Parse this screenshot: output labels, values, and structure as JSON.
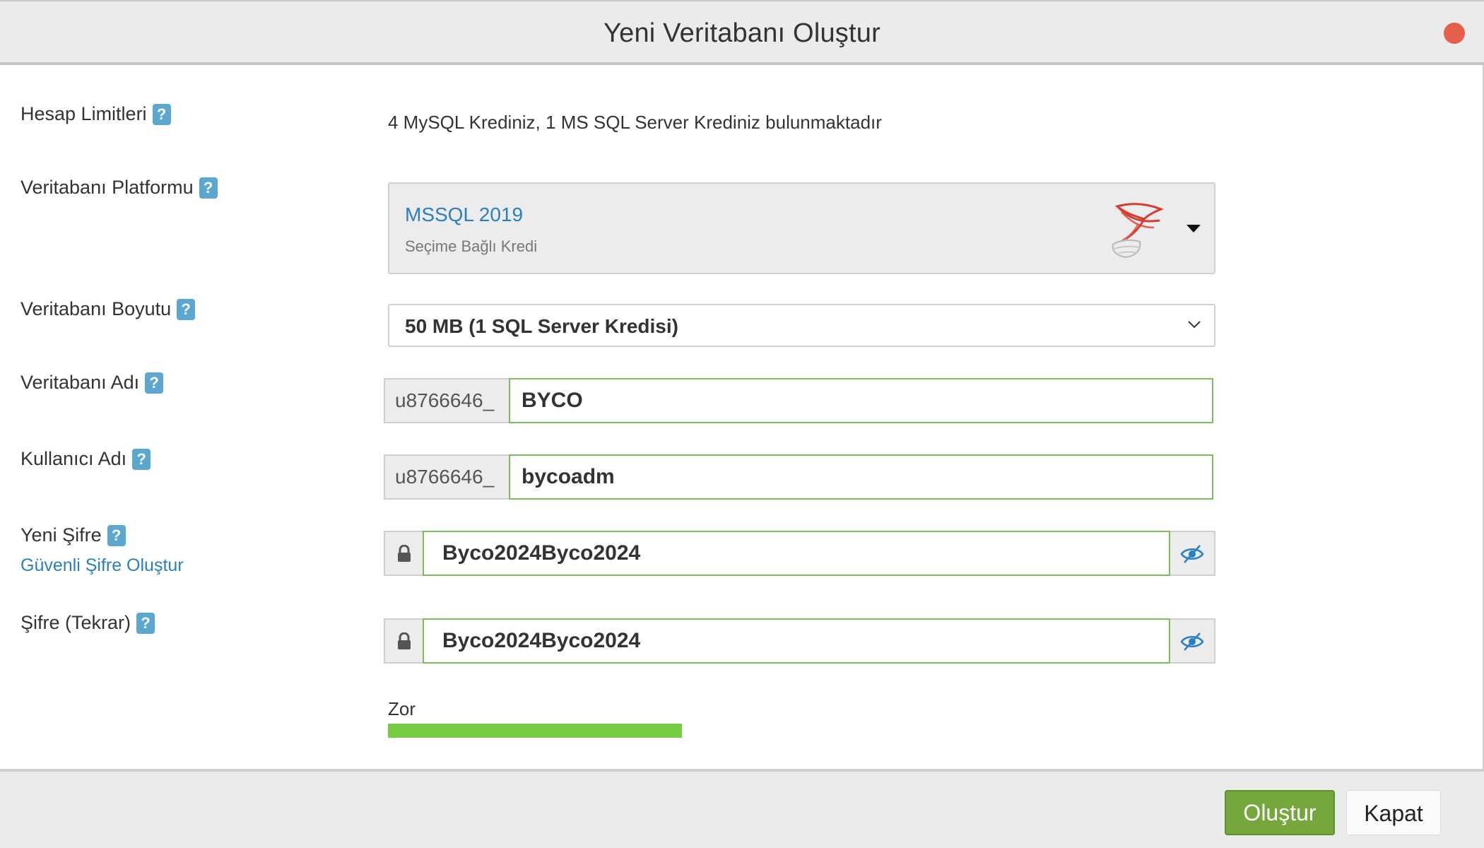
{
  "dialog": {
    "title": "Yeni Veritabanı Oluştur"
  },
  "fields": {
    "account_limits": {
      "label": "Hesap Limitleri",
      "help": "?",
      "value": "4 MySQL Krediniz, 1 MS SQL Server Krediniz bulunmaktadır"
    },
    "platform": {
      "label": "Veritabanı Platformu",
      "help": "?",
      "selected": "MSSQL 2019",
      "subtitle": "Seçime Bağlı Kredi",
      "icon": "sql-server-icon"
    },
    "size": {
      "label": "Veritabanı Boyutu",
      "help": "?",
      "selected": "50 MB (1 SQL Server Kredisi)"
    },
    "db_name": {
      "label": "Veritabanı Adı",
      "help": "?",
      "prefix": "u8766646_",
      "value": "BYCO"
    },
    "username": {
      "label": "Kullanıcı Adı",
      "help": "?",
      "prefix": "u8766646_",
      "value": "bycoadm"
    },
    "new_password": {
      "label": "Yeni Şifre",
      "help": "?",
      "generate_link": "Güvenli Şifre Oluştur",
      "value": "Byco2024Byco2024"
    },
    "password_repeat": {
      "label": "Şifre (Tekrar)",
      "help": "?",
      "value": "Byco2024Byco2024"
    }
  },
  "strength": {
    "label": "Zor",
    "level": 1.0,
    "color": "#77cc44"
  },
  "footer": {
    "create_label": "Oluştur",
    "close_label": "Kapat"
  },
  "colors": {
    "accent_blue": "#2a7fc1",
    "help_badge": "#5ba7d0",
    "valid_border": "#7bbd59",
    "primary_button": "#75a73d",
    "close_dot": "#e5604a"
  }
}
